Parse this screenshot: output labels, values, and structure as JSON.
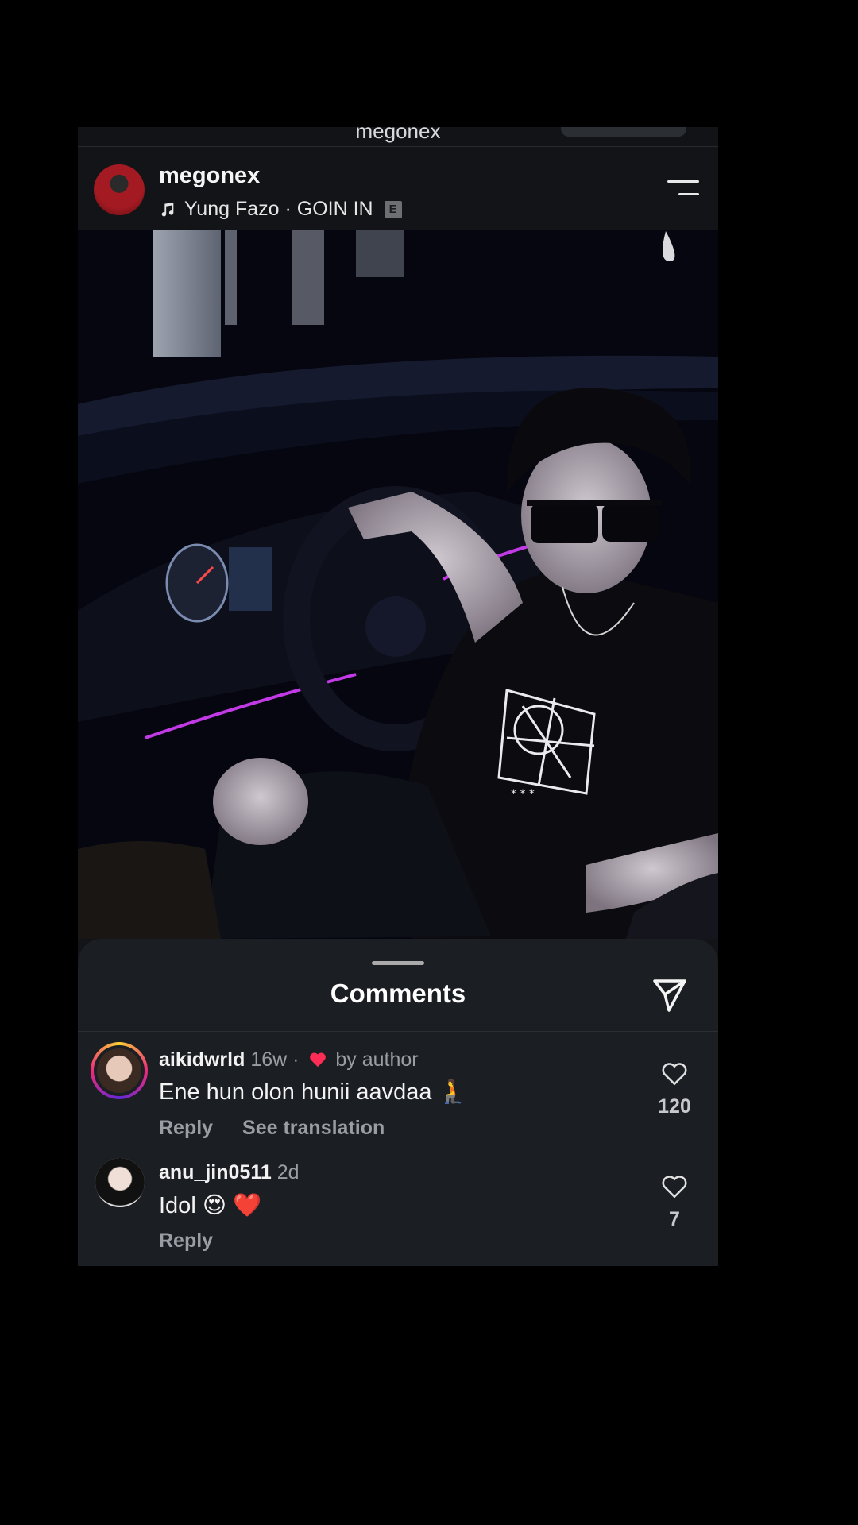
{
  "topbar": {
    "title": "megonex"
  },
  "post": {
    "username": "megonex",
    "music": "Yung Fazo · GOIN IN",
    "explicit_badge": "E"
  },
  "comments_sheet": {
    "title": "Comments",
    "comments": [
      {
        "username": "aikidwrld",
        "time": "16w",
        "liked_by": "by author",
        "text": "Ene hun olon hunii aavdaa 🧎",
        "reply": "Reply",
        "translate": "See translation",
        "likes": "120"
      },
      {
        "username": "anu_jin0511",
        "time": "2d",
        "text": "Idol 😍 ❤️",
        "reply": "Reply",
        "likes": "7"
      }
    ]
  },
  "colors": {
    "background": "#000000",
    "sheet": "#1b1e22",
    "heart": "#ff2d55"
  },
  "icons": [
    "music-note-icon",
    "menu-icon",
    "send-icon",
    "heart-outline-icon",
    "heart-filled-icon"
  ]
}
